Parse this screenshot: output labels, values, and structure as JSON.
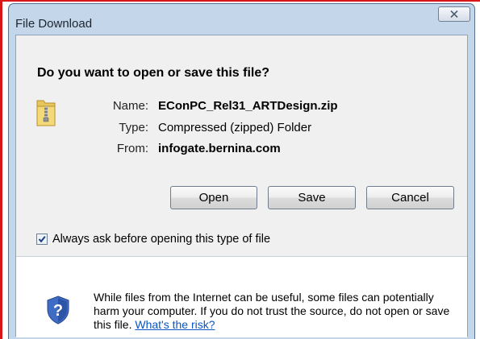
{
  "dialog": {
    "title": "File Download",
    "question": "Do you want to open or save this file?",
    "fields": {
      "name_label": "Name:",
      "name_value": "EConPC_Rel31_ARTDesign.zip",
      "type_label": "Type:",
      "type_value": "Compressed (zipped) Folder",
      "from_label": "From:",
      "from_value": "infogate.bernina.com"
    },
    "buttons": {
      "open": "Open",
      "save": "Save",
      "cancel": "Cancel"
    },
    "checkbox": {
      "label": "Always ask before opening this type of file",
      "checked": true
    },
    "warning": {
      "text": "While files from the Internet can be useful, some files can potentially harm your computer. If you do not trust the source, do not open or save this file.",
      "link": "What's the risk?"
    },
    "icons": {
      "file": "zip-folder-icon",
      "warning": "security-shield-question-icon",
      "close": "close-icon"
    }
  }
}
